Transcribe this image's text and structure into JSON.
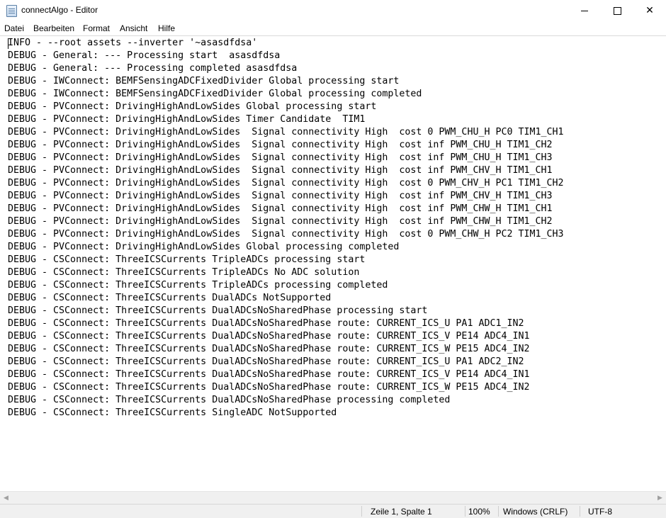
{
  "window": {
    "title": "connectAlgo - Editor",
    "icon": "notepad-icon"
  },
  "menu": [
    "Datei",
    "Bearbeiten",
    "Format",
    "Ansicht",
    "Hilfe"
  ],
  "editor": {
    "lines": [
      "INFO - --root assets --inverter '~asasdfdsa'",
      "DEBUG - General: --- Processing start  asasdfdsa",
      "DEBUG - General: --- Processing completed asasdfdsa",
      "DEBUG - IWConnect: BEMFSensingADCFixedDivider Global processing start",
      "DEBUG - IWConnect: BEMFSensingADCFixedDivider Global processing completed",
      "DEBUG - PVConnect: DrivingHighAndLowSides Global processing start",
      "DEBUG - PVConnect: DrivingHighAndLowSides Timer Candidate  TIM1",
      "DEBUG - PVConnect: DrivingHighAndLowSides  Signal connectivity High  cost 0 PWM_CHU_H PC0 TIM1_CH1",
      "DEBUG - PVConnect: DrivingHighAndLowSides  Signal connectivity High  cost inf PWM_CHU_H TIM1_CH2",
      "DEBUG - PVConnect: DrivingHighAndLowSides  Signal connectivity High  cost inf PWM_CHU_H TIM1_CH3",
      "DEBUG - PVConnect: DrivingHighAndLowSides  Signal connectivity High  cost inf PWM_CHV_H TIM1_CH1",
      "DEBUG - PVConnect: DrivingHighAndLowSides  Signal connectivity High  cost 0 PWM_CHV_H PC1 TIM1_CH2",
      "DEBUG - PVConnect: DrivingHighAndLowSides  Signal connectivity High  cost inf PWM_CHV_H TIM1_CH3",
      "DEBUG - PVConnect: DrivingHighAndLowSides  Signal connectivity High  cost inf PWM_CHW_H TIM1_CH1",
      "DEBUG - PVConnect: DrivingHighAndLowSides  Signal connectivity High  cost inf PWM_CHW_H TIM1_CH2",
      "DEBUG - PVConnect: DrivingHighAndLowSides  Signal connectivity High  cost 0 PWM_CHW_H PC2 TIM1_CH3",
      "DEBUG - PVConnect: DrivingHighAndLowSides Global processing completed",
      "DEBUG - CSConnect: ThreeICSCurrents TripleADCs processing start",
      "DEBUG - CSConnect: ThreeICSCurrents TripleADCs No ADC solution",
      "DEBUG - CSConnect: ThreeICSCurrents TripleADCs processing completed",
      "DEBUG - CSConnect: ThreeICSCurrents DualADCs NotSupported",
      "DEBUG - CSConnect: ThreeICSCurrents DualADCsNoSharedPhase processing start",
      "DEBUG - CSConnect: ThreeICSCurrents DualADCsNoSharedPhase route: CURRENT_ICS_U PA1 ADC1_IN2",
      "DEBUG - CSConnect: ThreeICSCurrents DualADCsNoSharedPhase route: CURRENT_ICS_V PE14 ADC4_IN1",
      "DEBUG - CSConnect: ThreeICSCurrents DualADCsNoSharedPhase route: CURRENT_ICS_W PE15 ADC4_IN2",
      "DEBUG - CSConnect: ThreeICSCurrents DualADCsNoSharedPhase route: CURRENT_ICS_U PA1 ADC2_IN2",
      "DEBUG - CSConnect: ThreeICSCurrents DualADCsNoSharedPhase route: CURRENT_ICS_V PE14 ADC4_IN1",
      "DEBUG - CSConnect: ThreeICSCurrents DualADCsNoSharedPhase route: CURRENT_ICS_W PE15 ADC4_IN2",
      "DEBUG - CSConnect: ThreeICSCurrents DualADCsNoSharedPhase processing completed",
      "DEBUG - CSConnect: ThreeICSCurrents SingleADC NotSupported"
    ]
  },
  "status": {
    "position": "Zeile 1, Spalte 1",
    "zoom": "100%",
    "line_ending": "Windows (CRLF)",
    "encoding": "UTF-8"
  }
}
